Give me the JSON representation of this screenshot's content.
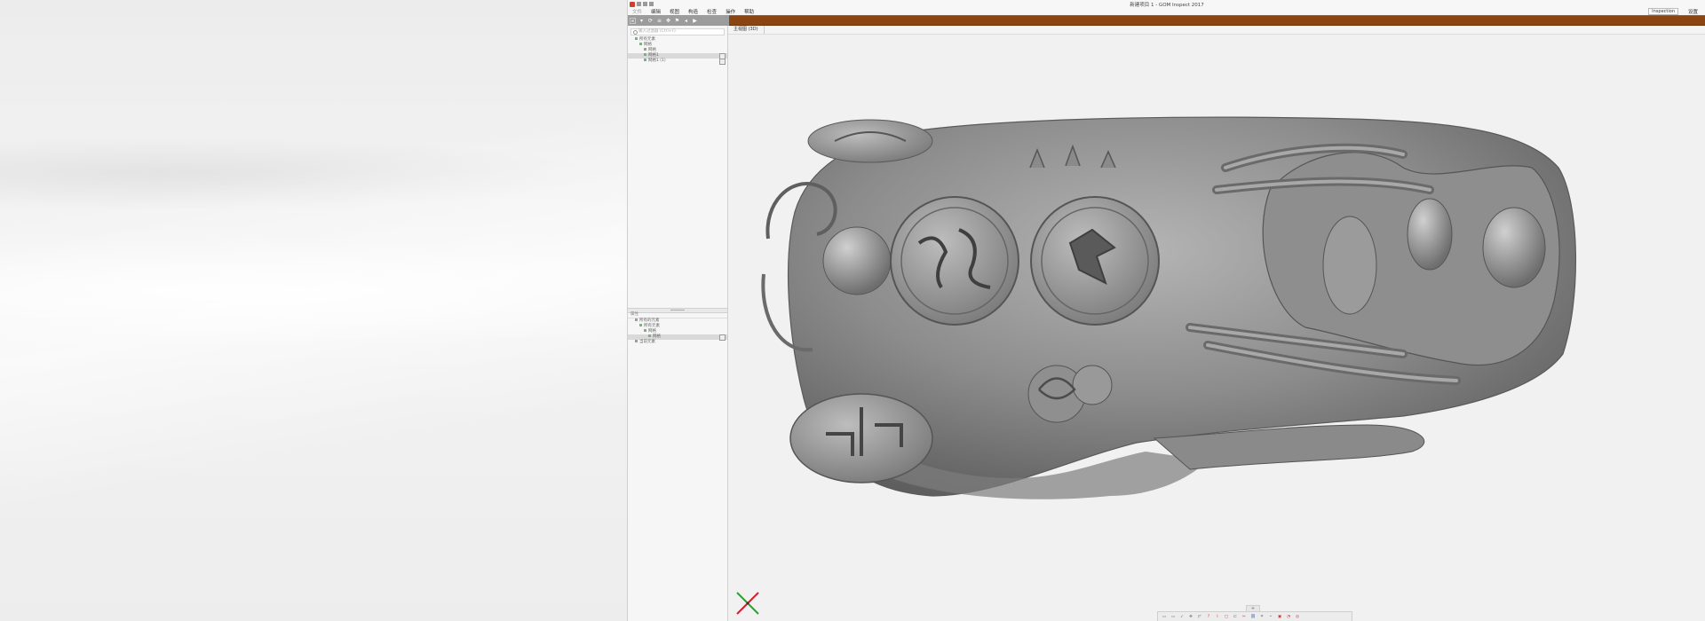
{
  "window": {
    "title": "新建项目 1 - GOM Inspect 2017"
  },
  "menubar": {
    "items": [
      "文件",
      "编辑",
      "视图",
      "构造",
      "检查",
      "操作",
      "帮助"
    ],
    "workspace": "Inspection",
    "workspace_suffix": "设置"
  },
  "explorer": {
    "search_placeholder": "输入过滤器 (Ctrl+F)",
    "tree": [
      {
        "label": "所有元素",
        "depth": 1
      },
      {
        "label": "网格",
        "depth": 2
      },
      {
        "label": "网格",
        "depth": 3
      },
      {
        "label": "网格1",
        "depth": 3,
        "selected": true
      },
      {
        "label": "网格1 (1)",
        "depth": 3
      }
    ]
  },
  "properties": {
    "header": "属性",
    "tree": [
      {
        "label": "所有的元素",
        "depth": 1
      },
      {
        "label": "所有元素",
        "depth": 2
      },
      {
        "label": "网格",
        "depth": 3
      },
      {
        "label": "网格",
        "depth": 4,
        "selected": true
      },
      {
        "label": "当前元素",
        "depth": 1
      }
    ]
  },
  "view": {
    "tab_label": "主视图 (3D)",
    "handle_glyph": "+"
  },
  "icons": [
    "app-logo-icon",
    "save-icon",
    "undo-icon",
    "redo-icon",
    "select-icon",
    "rotate-icon",
    "search-icon",
    "axes-icon"
  ],
  "colors": {
    "accent_strip": "#8b4513",
    "toolbar_gray": "#9c9c9c",
    "model_gray": "#8a8a8a"
  }
}
